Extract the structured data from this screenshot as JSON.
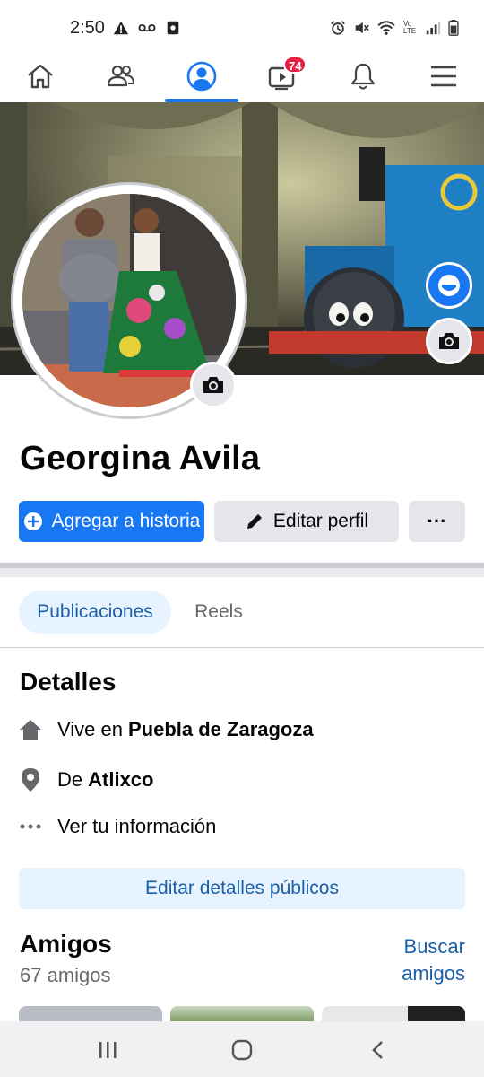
{
  "status_bar": {
    "time": "2:50",
    "left_icons": [
      "warning-icon",
      "voicemail-icon",
      "screen-record-icon"
    ],
    "right_icons": [
      "alarm-icon",
      "mute-icon",
      "wifi-icon",
      "volte-icon",
      "signal-icon",
      "battery-icon"
    ],
    "volte_label": "Vo LTE"
  },
  "nav": {
    "items": [
      "home-icon",
      "friends-icon",
      "profile-icon",
      "video-icon",
      "bell-icon",
      "menu-icon"
    ],
    "active": "profile",
    "video_badge": "74"
  },
  "profile": {
    "name": "Georgina Avila"
  },
  "actions": {
    "add_story": "Agregar a historia",
    "edit_profile": "Editar perfil",
    "more": "···"
  },
  "tabs": [
    {
      "label": "Publicaciones",
      "active": true
    },
    {
      "label": "Reels",
      "active": false
    }
  ],
  "details": {
    "title": "Detalles",
    "lives_prefix": "Vive en",
    "lives_place": "Puebla de Zaragoza",
    "from_prefix": "De",
    "from_place": "Atlixco",
    "see_info": "Ver tu información",
    "edit_button": "Editar detalles públicos"
  },
  "friends": {
    "title": "Amigos",
    "count": "67 amigos",
    "find_line1": "Buscar",
    "find_line2": "amigos"
  },
  "colors": {
    "accent": "#1877f2",
    "link": "#1b5fa8",
    "badge": "#e41e3f",
    "secondary_button": "#e4e6eb",
    "light_accent": "#e7f3ff"
  }
}
